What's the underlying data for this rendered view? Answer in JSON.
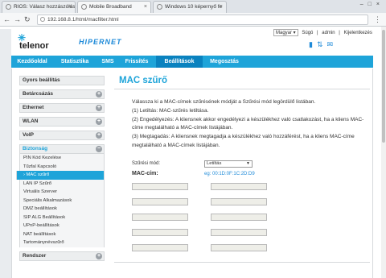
{
  "browser": {
    "tabs": [
      {
        "label": "RIOS: Válasz hozzászólás"
      },
      {
        "label": "Mobile Broadband"
      },
      {
        "label": "Windows 10 képernyő fe"
      }
    ],
    "url": "192.168.8.1/html/macfilter.html"
  },
  "header": {
    "brand": "telenor",
    "brand_mark": "✳",
    "product": "HIPERNET",
    "language": "Magyar ▾",
    "links": [
      "Súgó",
      "admin",
      "Kijelentkezés"
    ]
  },
  "nav": {
    "items": [
      "Kezdőoldal",
      "Statisztika",
      "SMS",
      "Frissítés",
      "Beállítások",
      "Megosztás"
    ],
    "active": "Beállítások"
  },
  "sidebar": {
    "sections": [
      {
        "label": "Gyors beállítás",
        "expand": false
      },
      {
        "label": "Betárcsázás",
        "expand": true
      },
      {
        "label": "Ethernet",
        "expand": true
      },
      {
        "label": "WLAN",
        "expand": true
      },
      {
        "label": "VoIP",
        "expand": true
      },
      {
        "label": "Biztonság",
        "expand": true,
        "open": true
      },
      {
        "label": "Rendszer",
        "expand": true
      }
    ],
    "security_items": [
      "PIN Kód Kezelése",
      "Tűzfal Kapcsoló",
      "MAC szűrő",
      "LAN IP Szűrő",
      "Virtuális Szerver",
      "Speciális Alkalmazások",
      "DMZ beállítások",
      "SIP ALG Beállítások",
      "UPnP-beállítások",
      "NAT beállítások",
      "Tartománynévszűrő"
    ],
    "active_item": "MAC szűrő"
  },
  "content": {
    "title": "MAC szűrő",
    "description": [
      "Válassza ki a MAC-címek szűrésének módját a Szűrési mód legördülő listában.",
      "(1) Letiltás: MAC-szűrés letiltása.",
      "(2) Engedélyezés: A kliensnek akkor engedélyezi a készülékhez való csatlakozást, ha a kliens MAC-címe megtalálható a MAC-címek listájában.",
      "(3) Megtagadás: A kliensnek megtagadja a készülékhez való hozzáférést, ha a kliens MAC-címe megtalálható a MAC-címek listájában."
    ],
    "mode_label": "Szűrési mód:",
    "mode_value": "Letiltás",
    "mac_label": "MAC-cím:",
    "mac_example": "eg: 00:1D:0F:1C:2D:D9",
    "mac_fields": [
      "",
      "",
      "",
      "",
      "",
      "",
      "",
      "",
      "",
      ""
    ]
  },
  "colors": {
    "accent": "#1ea4d9",
    "nav_active": "#0a82bf",
    "link": "#1e8ad8"
  }
}
